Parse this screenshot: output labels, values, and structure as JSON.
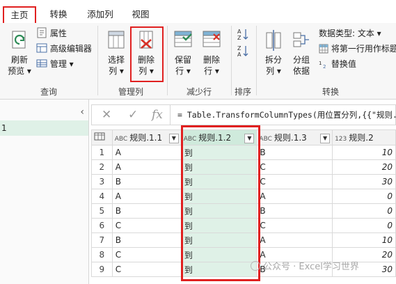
{
  "tabs": [
    {
      "label": "主页",
      "active": true
    },
    {
      "label": "转换",
      "active": false
    },
    {
      "label": "添加列",
      "active": false
    },
    {
      "label": "视图",
      "active": false
    }
  ],
  "ribbon": {
    "query": {
      "refresh_label_1": "刷新",
      "refresh_label_2": "预览",
      "properties": "属性",
      "advanced_editor": "高级编辑器",
      "manage": "管理",
      "group_label": "查询"
    },
    "manage_columns": {
      "choose_label_1": "选择",
      "choose_label_2": "列",
      "remove_label_1": "删除",
      "remove_label_2": "列",
      "group_label": "管理列"
    },
    "reduce_rows": {
      "keep_label_1": "保留",
      "keep_label_2": "行",
      "remove_label_1": "删除",
      "remove_label_2": "行",
      "group_label": "减少行"
    },
    "sort": {
      "group_label": "排序"
    },
    "transform": {
      "split_label_1": "拆分",
      "split_label_2": "列",
      "group_by_1": "分组",
      "group_by_2": "依据",
      "data_type": "数据类型: 文本",
      "first_row_header": "将第一行用作标题",
      "replace_values": "替换值",
      "group_label": "转换"
    }
  },
  "left_pane": {
    "item_label": "1"
  },
  "formula_bar": {
    "formula": "= Table.TransformColumnTypes(用位置分列,{{\"规则.1"
  },
  "grid": {
    "columns": [
      {
        "type": "ABC",
        "name": "规则.1.1"
      },
      {
        "type": "ABC",
        "name": "规则.1.2"
      },
      {
        "type": "ABC",
        "name": "规则.1.3"
      },
      {
        "type": "123",
        "name": "规则.2"
      }
    ],
    "rows": [
      {
        "n": "1",
        "c1": "A",
        "c2": "到",
        "c3": "B",
        "c4": "10"
      },
      {
        "n": "2",
        "c1": "A",
        "c2": "到",
        "c3": "C",
        "c4": "20"
      },
      {
        "n": "3",
        "c1": "B",
        "c2": "到",
        "c3": "C",
        "c4": "30"
      },
      {
        "n": "4",
        "c1": "A",
        "c2": "到",
        "c3": "A",
        "c4": "0"
      },
      {
        "n": "5",
        "c1": "B",
        "c2": "到",
        "c3": "B",
        "c4": "0"
      },
      {
        "n": "6",
        "c1": "C",
        "c2": "到",
        "c3": "C",
        "c4": "0"
      },
      {
        "n": "7",
        "c1": "B",
        "c2": "到",
        "c3": "A",
        "c4": "10"
      },
      {
        "n": "8",
        "c1": "C",
        "c2": "到",
        "c3": "A",
        "c4": "20"
      },
      {
        "n": "9",
        "c1": "C",
        "c2": "到",
        "c3": "B",
        "c4": "30"
      }
    ]
  },
  "watermark": "公众号 · Excel学习世界",
  "colors": {
    "highlight": "#e02020",
    "selected_column": "#dff1e7",
    "accent_green": "#2e8b57"
  }
}
